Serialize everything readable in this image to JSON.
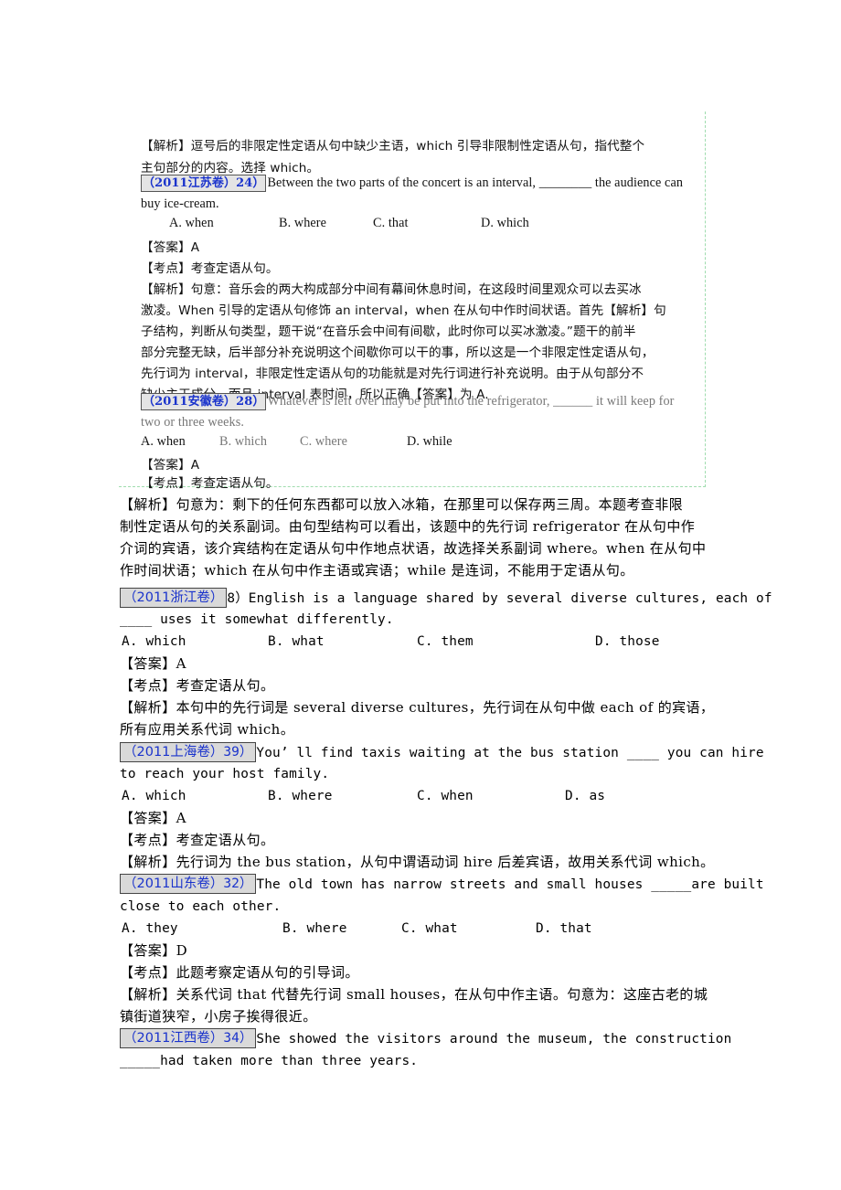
{
  "embedded_image": {
    "lines": {
      "l1": "【解析】逗号后的非限定性定语从句中缺少主语，which 引导非限制性定语从句，指代整个",
      "l2": "主句部分的内容。选择 which。",
      "q1_tag": "（2011江苏卷）24）",
      "q1_text": "Between the two parts of the concert is an interval, ________ the audience can",
      "q1_text2": "buy ice-cream.",
      "q1_options": [
        "A. when",
        "B. where",
        "C. that",
        "D. which"
      ],
      "q1_answer": "【答案】A",
      "q1_point": "【考点】考查定语从句。",
      "q1_analysis": [
        "【解析】句意：音乐会的两大构成部分中间有幕间休息时间，在这段时间里观众可以去买冰",
        "激凌。When 引导的定语从句修饰 an interval，when 在从句中作时间状语。首先【解析】句",
        "子结构，判断从句类型，题干说“在音乐会中间有间歇，此时你可以买冰激凌。”题干的前半",
        "部分完整无缺，后半部分补充说明这个间歇你可以干的事，所以这是一个非限定性定语从句，",
        "先行词为  interval，非限定性定语从句的功能就是对先行词进行补充说明。由于从句部分不",
        "缺少主干成分，而且 interval 表时间，所以正确【答案】为 A."
      ],
      "q2_tag": "（2011安徽卷）28）",
      "q2_text": "Whatever is left over may be put into the refrigerator, ______ it will keep for",
      "q2_text2": "two or three weeks.",
      "q2_options": [
        "A. when",
        "B. which",
        "C. where",
        "D. while"
      ],
      "q2_answer": "【答案】A",
      "q2_point": "【考点】考查定语从句。"
    }
  },
  "document": {
    "q2_analysis": [
      "【解析】句意为：剩下的任何东西都可以放入冰箱，在那里可以保存两三周。本题考查非限",
      "制性定语从句的关系副词。由句型结构可以看出，该题中的先行词 refrigerator 在从句中作",
      "介词的宾语，该介宾结构在定语从句中作地点状语，故选择关系副词 where。when 在从句中",
      "作时间状语；which 在从句中作主语或宾语；while 是连词，不能用于定语从句。"
    ],
    "questions": [
      {
        "tag": "（2011浙江卷）",
        "num": "8）",
        "text": "English is a language shared by several diverse cultures, each of",
        "text2": "____ uses it somewhat differently.",
        "options": [
          "A. which",
          "B. what",
          "C. them",
          "D. those"
        ],
        "answer": "【答案】A",
        "point": "【考点】考查定语从句。",
        "analysis": [
          "【解析】本句中的先行词是 several diverse cultures，先行词在从句中做 each of 的宾语，",
          "所有应用关系代词 which。"
        ]
      },
      {
        "tag": "（2011上海卷）",
        "num": "39）",
        "text": "You’ ll find taxis waiting at the bus station ____ you can hire",
        "text2": "to reach your host family.",
        "options": [
          "A. which",
          "B. where",
          "C. when",
          "D. as"
        ],
        "answer": "【答案】A",
        "point": "【考点】考查定语从句。",
        "analysis": [
          "【解析】先行词为 the bus station，从句中谓语动词 hire 后差宾语，故用关系代词 which。"
        ]
      },
      {
        "tag": "（2011山东卷）",
        "num": "32）",
        "text": "The old town has narrow streets and small houses _____are built",
        "text2": "close to each other.",
        "options": [
          "A. they",
          "B. where",
          "C. what",
          "D. that"
        ],
        "answer": "【答案】D",
        "point": "【考点】此题考察定语从句的引导词。",
        "analysis": [
          "【解析】关系代词 that 代替先行词 small houses，在从句中作主语。句意为：这座古老的城",
          "镇街道狭窄，小房子挨得很近。"
        ]
      },
      {
        "tag": "（2011江西卷）",
        "num": "34）",
        "text": "She showed the visitors around the museum, the construction",
        "text2": "_____had taken more than three years."
      }
    ]
  }
}
